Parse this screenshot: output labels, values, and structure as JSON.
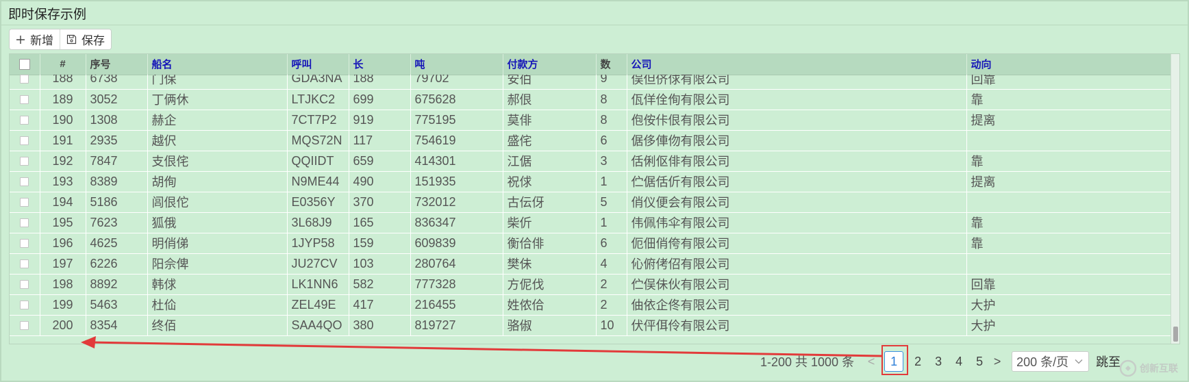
{
  "panel": {
    "title": "即时保存示例"
  },
  "toolbar": {
    "add_label": "新增",
    "save_label": "保存"
  },
  "columns": [
    "#",
    "序号",
    "船名",
    "呼叫",
    "长",
    "吨",
    "付款方",
    "数",
    "公司",
    "动向"
  ],
  "rows": [
    [
      "188",
      "6738",
      "门保",
      "GDA3NA",
      "188",
      "79702",
      "安伯",
      "9",
      "俣但侪俅有限公司",
      "回靠"
    ],
    [
      "189",
      "3052",
      "丁俩休",
      "LTJKC2",
      "699",
      "675628",
      "郝佷",
      "8",
      "佤佯佺侚有限公司",
      "靠"
    ],
    [
      "190",
      "1308",
      "赫企",
      "7CT7P2",
      "919",
      "775195",
      "莫俳",
      "8",
      "佨侒佧佷有限公司",
      "提离"
    ],
    [
      "191",
      "2935",
      "越伬",
      "MQS72N",
      "117",
      "754619",
      "盛侘",
      "6",
      "倨侈俥伆有限公司",
      ""
    ],
    [
      "192",
      "7847",
      "支佷侘",
      "QQIIDT",
      "659",
      "414301",
      "江倨",
      "3",
      "佸俐伛俳有限公司",
      "靠"
    ],
    [
      "193",
      "8389",
      "胡侚",
      "N9ME44",
      "490",
      "151935",
      "祝俅",
      "1",
      "伫倨佸伒有限公司",
      "提离"
    ],
    [
      "194",
      "5186",
      "闾佷佗",
      "E0356Y",
      "370",
      "732012",
      "古伝伢",
      "5",
      "俏仪便会有限公司",
      ""
    ],
    [
      "195",
      "7623",
      "狐俄",
      "3L68J9",
      "165",
      "836347",
      "柴伒",
      "1",
      "伟佩伟伞有限公司",
      "靠"
    ],
    [
      "196",
      "4625",
      "明俏俤",
      "1JYP58",
      "159",
      "609839",
      "衡佮俳",
      "6",
      "伌佃俏侉有限公司",
      "靠"
    ],
    [
      "197",
      "6226",
      "阳佘俾",
      "JU27CV",
      "103",
      "280764",
      "樊佅",
      "4",
      "伈俯侤佋有限公司",
      ""
    ],
    [
      "198",
      "8892",
      "韩俅",
      "LK1NN6",
      "582",
      "777328",
      "方伲伐",
      "2",
      "伫俣佅伙有限公司",
      "回靠"
    ],
    [
      "199",
      "5463",
      "杜佡",
      "ZEL49E",
      "417",
      "216455",
      "姓侬佮",
      "2",
      "伷依企佟有限公司",
      "大护"
    ],
    [
      "200",
      "8354",
      "终佰",
      "SAA4QO",
      "380",
      "819727",
      "骆俶",
      "10",
      "伏伻佴伶有限公司",
      "大护"
    ]
  ],
  "pager": {
    "total": "1-200 共 1000 条",
    "prev": "<",
    "next": ">",
    "pages": [
      "1",
      "2",
      "3",
      "4",
      "5"
    ],
    "page_size": "200 条/页",
    "jump_label": "跳至"
  },
  "watermark": {
    "text": "创新互联"
  },
  "colors": {
    "background": "#cdeed4",
    "header": "#b6dabf",
    "header_text": "#1515b8",
    "active_page": "#3b8fe0",
    "highlight": "#e23a3a"
  }
}
